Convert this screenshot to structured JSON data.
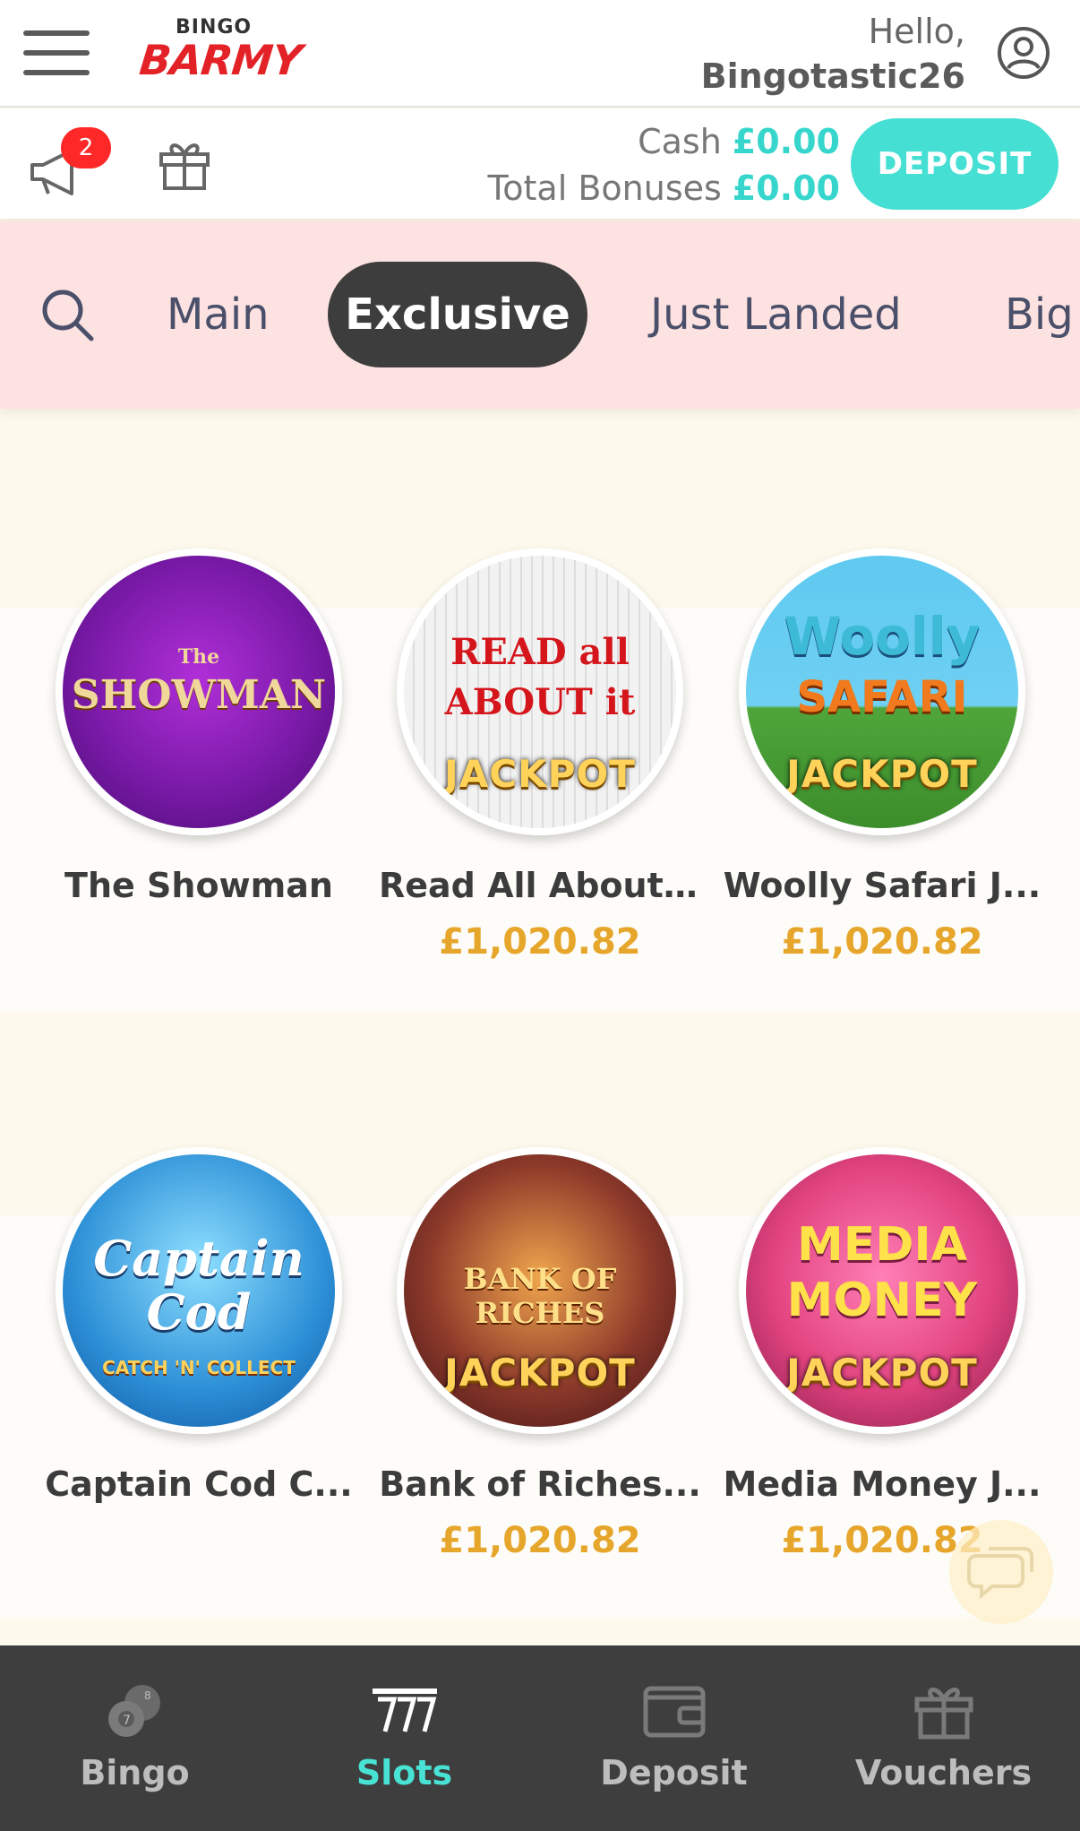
{
  "header": {
    "logo_top": "BINGO",
    "logo_main": "BARMY",
    "greeting": "Hello,",
    "username": "Bingotastic26"
  },
  "balance": {
    "notification_count": "2",
    "cash_label": "Cash",
    "cash_value": "£0.00",
    "bonus_label": "Total Bonuses",
    "bonus_value": "£0.00",
    "deposit_label": "DEPOSIT"
  },
  "categories": {
    "tabs": [
      {
        "label": "Main"
      },
      {
        "label": "Exclusive",
        "active": true
      },
      {
        "label": "Just Landed"
      },
      {
        "label": "Big"
      }
    ]
  },
  "games": [
    {
      "name": "The Showman",
      "jackpot": "",
      "art_title": "SHOWMAN",
      "art_sub": "The",
      "art_badge": ""
    },
    {
      "name": "Read All About...",
      "jackpot": "£1,020.82",
      "art_title": "READ all ABOUT it",
      "art_sub": "",
      "art_badge": "JACKPOT"
    },
    {
      "name": "Woolly Safari J...",
      "jackpot": "£1,020.82",
      "art_title": "Woolly",
      "art_sub": "SAFARI",
      "art_badge": "JACKPOT"
    },
    {
      "name": "Captain Cod C...",
      "jackpot": "",
      "art_title": "Captain Cod",
      "art_sub": "CATCH 'N' COLLECT",
      "art_badge": ""
    },
    {
      "name": "Bank of Riches...",
      "jackpot": "£1,020.82",
      "art_title": "BANK OF RICHES",
      "art_sub": "",
      "art_badge": "JACKPOT"
    },
    {
      "name": "Media Money J...",
      "jackpot": "£1,020.82",
      "art_title": "MEDIA MONEY",
      "art_sub": "",
      "art_badge": "JACKPOT"
    }
  ],
  "bottom_nav": {
    "items": [
      {
        "label": "Bingo",
        "icon": "bingo-balls-icon"
      },
      {
        "label": "Slots",
        "icon": "slots-777-icon",
        "active": true
      },
      {
        "label": "Deposit",
        "icon": "wallet-icon"
      },
      {
        "label": "Vouchers",
        "icon": "gift-icon"
      }
    ]
  },
  "colors": {
    "accent": "#45dfd3",
    "jackpot": "#e6a62b",
    "brand_red": "#e32227",
    "category_bg": "#fde2e2",
    "nav_bg": "#3e3e3e"
  }
}
